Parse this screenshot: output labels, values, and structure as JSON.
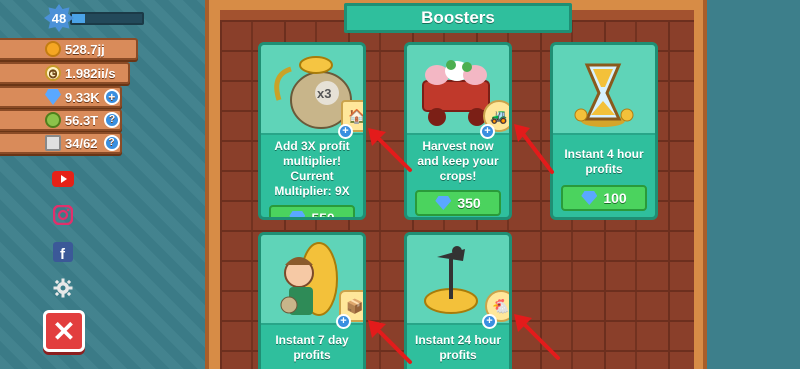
{
  "header": {
    "title": "Boosters"
  },
  "player": {
    "level": "48",
    "level_progress": 0.18
  },
  "resources": [
    {
      "name": "coins",
      "value": "528.7jj",
      "icon": "coin-icon",
      "action": ""
    },
    {
      "name": "income",
      "value": "1.982ii/s",
      "icon": "clock-icon",
      "action": ""
    },
    {
      "name": "gems",
      "value": "9.33K",
      "icon": "gem-icon",
      "action": "+"
    },
    {
      "name": "seeds",
      "value": "56.3T",
      "icon": "seed-icon",
      "action": "?"
    },
    {
      "name": "storage",
      "value": "34/62",
      "icon": "storage-icon",
      "action": "?"
    }
  ],
  "social": [
    "youtube-icon",
    "instagram-icon",
    "facebook-icon",
    "gear-icon"
  ],
  "close": {
    "label": "✕"
  },
  "boosters": [
    {
      "text": "Add 3X profit multiplier! Current Multiplier: 9X",
      "price": "550",
      "badge": "x3"
    },
    {
      "text": "Harvest now and keep your crops!",
      "price": "350"
    },
    {
      "text": "Instant 4 hour profits",
      "price": "100"
    },
    {
      "text": "Instant 7 day profits",
      "price": ""
    },
    {
      "text": "Instant 24 hour profits",
      "price": ""
    }
  ],
  "colors": {
    "panel": "#2fbf9d",
    "price_button": "#4bd35e",
    "close_button": "#e23e3e",
    "arrow": "#e31b1b"
  }
}
